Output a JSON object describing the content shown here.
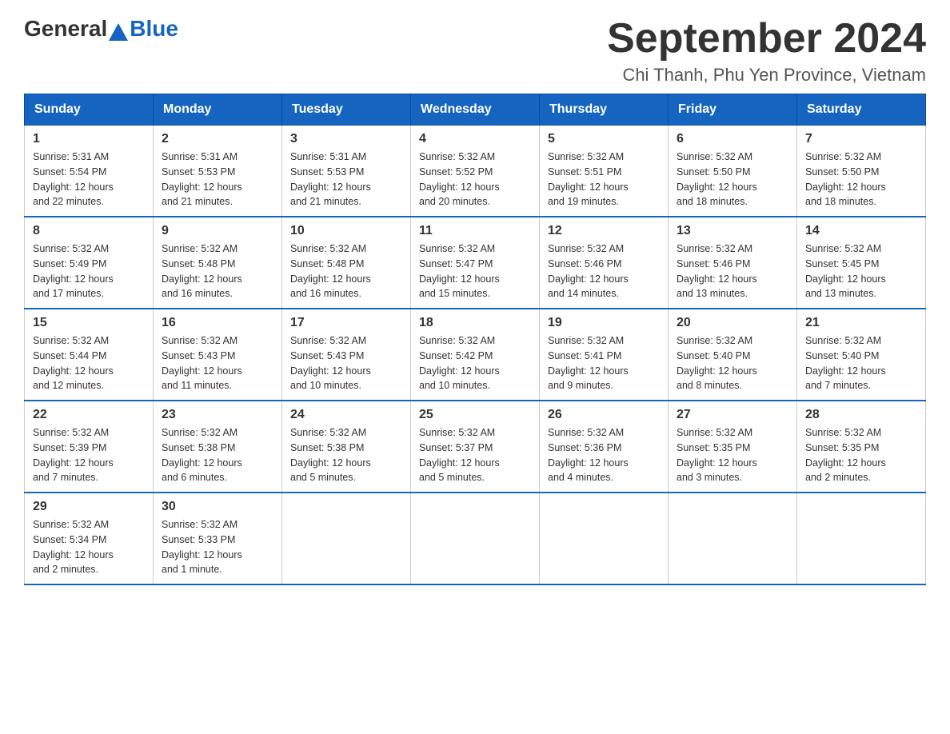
{
  "header": {
    "logo_general": "General",
    "logo_blue": "Blue",
    "title": "September 2024",
    "subtitle": "Chi Thanh, Phu Yen Province, Vietnam"
  },
  "weekdays": [
    "Sunday",
    "Monday",
    "Tuesday",
    "Wednesday",
    "Thursday",
    "Friday",
    "Saturday"
  ],
  "weeks": [
    [
      {
        "day": "1",
        "sunrise": "5:31 AM",
        "sunset": "5:54 PM",
        "daylight": "12 hours and 22 minutes."
      },
      {
        "day": "2",
        "sunrise": "5:31 AM",
        "sunset": "5:53 PM",
        "daylight": "12 hours and 21 minutes."
      },
      {
        "day": "3",
        "sunrise": "5:31 AM",
        "sunset": "5:53 PM",
        "daylight": "12 hours and 21 minutes."
      },
      {
        "day": "4",
        "sunrise": "5:32 AM",
        "sunset": "5:52 PM",
        "daylight": "12 hours and 20 minutes."
      },
      {
        "day": "5",
        "sunrise": "5:32 AM",
        "sunset": "5:51 PM",
        "daylight": "12 hours and 19 minutes."
      },
      {
        "day": "6",
        "sunrise": "5:32 AM",
        "sunset": "5:50 PM",
        "daylight": "12 hours and 18 minutes."
      },
      {
        "day": "7",
        "sunrise": "5:32 AM",
        "sunset": "5:50 PM",
        "daylight": "12 hours and 18 minutes."
      }
    ],
    [
      {
        "day": "8",
        "sunrise": "5:32 AM",
        "sunset": "5:49 PM",
        "daylight": "12 hours and 17 minutes."
      },
      {
        "day": "9",
        "sunrise": "5:32 AM",
        "sunset": "5:48 PM",
        "daylight": "12 hours and 16 minutes."
      },
      {
        "day": "10",
        "sunrise": "5:32 AM",
        "sunset": "5:48 PM",
        "daylight": "12 hours and 16 minutes."
      },
      {
        "day": "11",
        "sunrise": "5:32 AM",
        "sunset": "5:47 PM",
        "daylight": "12 hours and 15 minutes."
      },
      {
        "day": "12",
        "sunrise": "5:32 AM",
        "sunset": "5:46 PM",
        "daylight": "12 hours and 14 minutes."
      },
      {
        "day": "13",
        "sunrise": "5:32 AM",
        "sunset": "5:46 PM",
        "daylight": "12 hours and 13 minutes."
      },
      {
        "day": "14",
        "sunrise": "5:32 AM",
        "sunset": "5:45 PM",
        "daylight": "12 hours and 13 minutes."
      }
    ],
    [
      {
        "day": "15",
        "sunrise": "5:32 AM",
        "sunset": "5:44 PM",
        "daylight": "12 hours and 12 minutes."
      },
      {
        "day": "16",
        "sunrise": "5:32 AM",
        "sunset": "5:43 PM",
        "daylight": "12 hours and 11 minutes."
      },
      {
        "day": "17",
        "sunrise": "5:32 AM",
        "sunset": "5:43 PM",
        "daylight": "12 hours and 10 minutes."
      },
      {
        "day": "18",
        "sunrise": "5:32 AM",
        "sunset": "5:42 PM",
        "daylight": "12 hours and 10 minutes."
      },
      {
        "day": "19",
        "sunrise": "5:32 AM",
        "sunset": "5:41 PM",
        "daylight": "12 hours and 9 minutes."
      },
      {
        "day": "20",
        "sunrise": "5:32 AM",
        "sunset": "5:40 PM",
        "daylight": "12 hours and 8 minutes."
      },
      {
        "day": "21",
        "sunrise": "5:32 AM",
        "sunset": "5:40 PM",
        "daylight": "12 hours and 7 minutes."
      }
    ],
    [
      {
        "day": "22",
        "sunrise": "5:32 AM",
        "sunset": "5:39 PM",
        "daylight": "12 hours and 7 minutes."
      },
      {
        "day": "23",
        "sunrise": "5:32 AM",
        "sunset": "5:38 PM",
        "daylight": "12 hours and 6 minutes."
      },
      {
        "day": "24",
        "sunrise": "5:32 AM",
        "sunset": "5:38 PM",
        "daylight": "12 hours and 5 minutes."
      },
      {
        "day": "25",
        "sunrise": "5:32 AM",
        "sunset": "5:37 PM",
        "daylight": "12 hours and 5 minutes."
      },
      {
        "day": "26",
        "sunrise": "5:32 AM",
        "sunset": "5:36 PM",
        "daylight": "12 hours and 4 minutes."
      },
      {
        "day": "27",
        "sunrise": "5:32 AM",
        "sunset": "5:35 PM",
        "daylight": "12 hours and 3 minutes."
      },
      {
        "day": "28",
        "sunrise": "5:32 AM",
        "sunset": "5:35 PM",
        "daylight": "12 hours and 2 minutes."
      }
    ],
    [
      {
        "day": "29",
        "sunrise": "5:32 AM",
        "sunset": "5:34 PM",
        "daylight": "12 hours and 2 minutes."
      },
      {
        "day": "30",
        "sunrise": "5:32 AM",
        "sunset": "5:33 PM",
        "daylight": "12 hours and 1 minute."
      },
      null,
      null,
      null,
      null,
      null
    ]
  ],
  "labels": {
    "sunrise": "Sunrise:",
    "sunset": "Sunset:",
    "daylight": "Daylight:"
  }
}
